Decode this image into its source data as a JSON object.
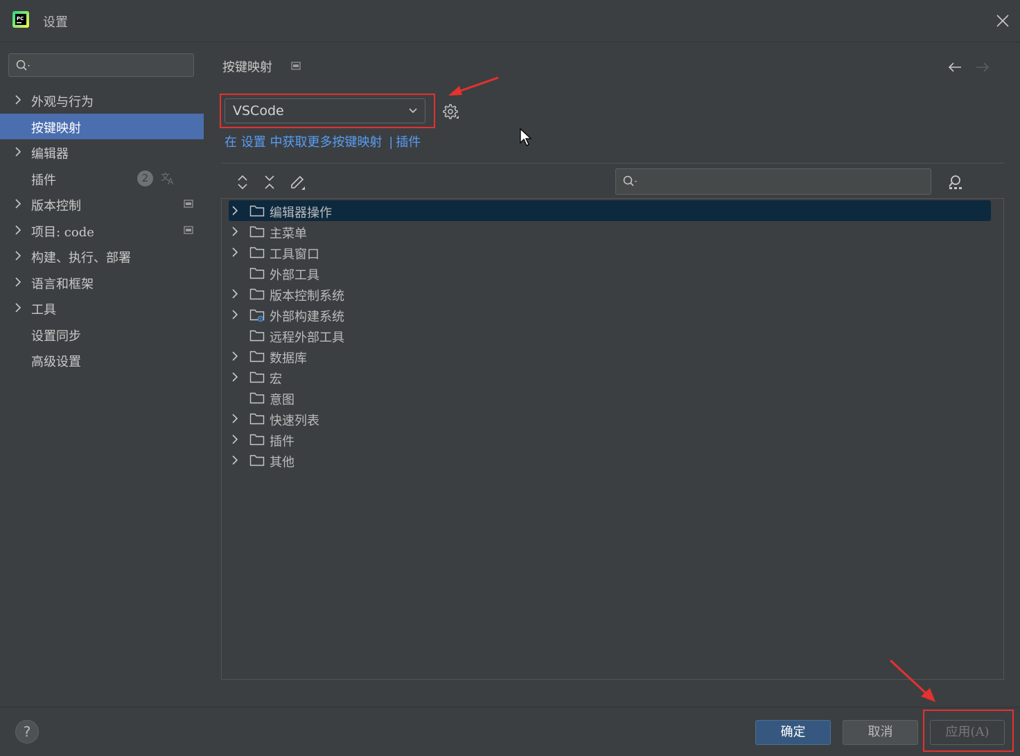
{
  "window": {
    "title": "设置",
    "app_icon": "pycharm-logo",
    "close_icon": "close-icon"
  },
  "sidebar": {
    "search_placeholder": "",
    "items": [
      {
        "label": "外观与行为",
        "expandable": true
      },
      {
        "label": "按键映射",
        "expandable": false,
        "selected": true
      },
      {
        "label": "编辑器",
        "expandable": true
      },
      {
        "label": "插件",
        "expandable": false,
        "badge": "2"
      },
      {
        "label": "版本控制",
        "expandable": true
      },
      {
        "label": "项目: code",
        "expandable": true
      },
      {
        "label": "构建、执行、部署",
        "expandable": true
      },
      {
        "label": "语言和框架",
        "expandable": true
      },
      {
        "label": "工具",
        "expandable": true
      },
      {
        "label": "设置同步",
        "expandable": false
      },
      {
        "label": "高级设置",
        "expandable": false
      }
    ]
  },
  "main": {
    "title": "按键映射",
    "keymap_select": {
      "value": "VSCode"
    },
    "link_row": {
      "prefix": "在 ",
      "settings_link": "设置",
      "middle": " 中获取更多按键映射 ",
      "separator": "|",
      "plugins_link": "插件"
    },
    "tree_search_placeholder": "",
    "tree": [
      {
        "label": "编辑器操作",
        "expandable": true,
        "selected": true
      },
      {
        "label": "主菜单",
        "expandable": true
      },
      {
        "label": "工具窗口",
        "expandable": true
      },
      {
        "label": "外部工具",
        "expandable": false
      },
      {
        "label": "版本控制系统",
        "expandable": true
      },
      {
        "label": "外部构建系统",
        "expandable": true,
        "special_icon": true
      },
      {
        "label": "远程外部工具",
        "expandable": false
      },
      {
        "label": "数据库",
        "expandable": true
      },
      {
        "label": "宏",
        "expandable": true
      },
      {
        "label": "意图",
        "expandable": false
      },
      {
        "label": "快速列表",
        "expandable": true
      },
      {
        "label": "插件",
        "expandable": true
      },
      {
        "label": "其他",
        "expandable": true
      }
    ]
  },
  "footer": {
    "help": "?",
    "ok": "确定",
    "cancel": "取消",
    "apply": "应用(A)"
  },
  "colors": {
    "background": "#3c3f41",
    "selection": "#4b6eaf",
    "tree_selection": "#0d293e",
    "link": "#589df6",
    "highlight_box": "#e5312f"
  }
}
